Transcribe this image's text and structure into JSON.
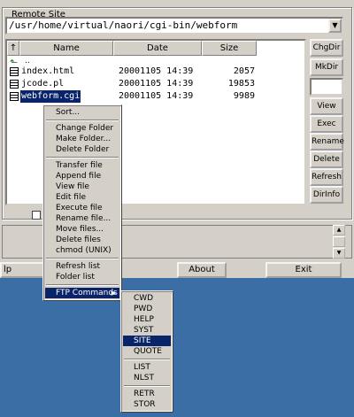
{
  "remote_site": {
    "title": "Remote Site",
    "path": "/usr/home/virtual/naori/cgi-bin/webform",
    "columns": [
      "Name",
      "Date",
      "Size"
    ],
    "parent_dir": "..",
    "files": [
      {
        "name": "index.html",
        "date": "20001105 14:39",
        "size": "2057"
      },
      {
        "name": "jcode.pl",
        "date": "20001105 14:39",
        "size": "19853"
      },
      {
        "name": "webform.cgi",
        "date": "20001105 14:39",
        "size": "9989"
      }
    ]
  },
  "side_buttons": [
    "ChgDir",
    "MkDir",
    "View",
    "Exec",
    "Rename",
    "Delete",
    "Refresh",
    "DirInfo"
  ],
  "bottom_buttons": {
    "help": "lp",
    "about": "About",
    "exit": "Exit"
  },
  "context_menu": {
    "sort": "Sort...",
    "change_folder": "Change Folder",
    "make_folder": "Make Folder...",
    "delete_folder": "Delete Folder",
    "transfer_file": "Transfer file",
    "append_file": "Append file",
    "view_file": "View file",
    "edit_file": "Edit file",
    "execute_file": "Execute file",
    "rename_file": "Rename file...",
    "move_files": "Move files...",
    "delete_files": "Delete files",
    "chmod": "chmod (UNIX)",
    "refresh_list": "Refresh list",
    "folder_list": "Folder list",
    "ftp_commands": "FTP Commands"
  },
  "ftp_submenu": {
    "cwd": "CWD",
    "pwd": "PWD",
    "help": "HELP",
    "syst": "SYST",
    "site": "SITE",
    "quote": "QUOTE",
    "list": "LIST",
    "nlst": "NLST",
    "retr": "RETR",
    "stor": "STOR"
  },
  "colors": {
    "desktop": "#3a6ea5",
    "selection": "#0a246a",
    "face": "#d4d0c8"
  }
}
